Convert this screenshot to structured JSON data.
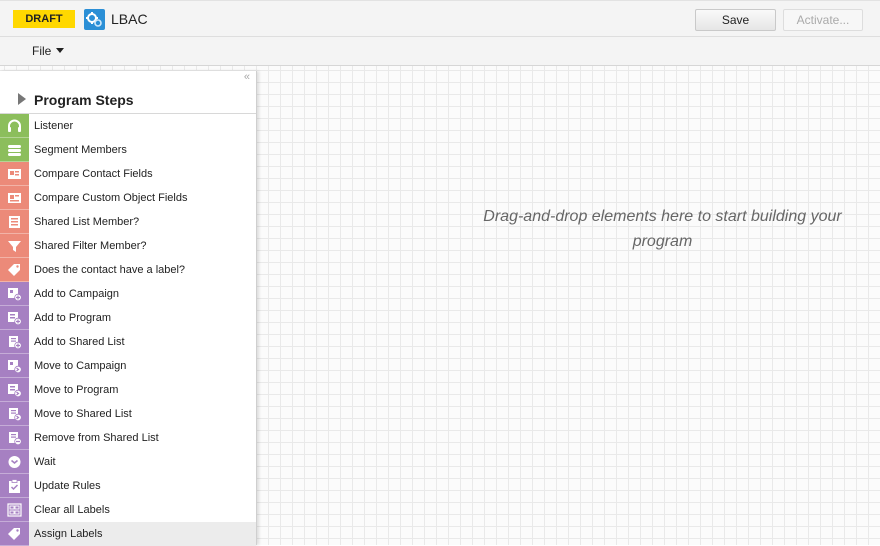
{
  "header": {
    "draft_badge": "DRAFT",
    "title": "LBAC",
    "save_label": "Save",
    "activate_label": "Activate..."
  },
  "menu": {
    "file_label": "File"
  },
  "canvas": {
    "hint": "Drag-and-drop elements here to start building your program"
  },
  "panel": {
    "collapse_glyph": "«",
    "title": "Program Steps",
    "steps": [
      {
        "label": "Listener",
        "icon": "headphones-icon",
        "color": "#8cbe5c"
      },
      {
        "label": "Segment Members",
        "icon": "segment-icon",
        "color": "#8cbe5c"
      },
      {
        "label": "Compare Contact Fields",
        "icon": "contact-card-icon",
        "color": "#ec8a79"
      },
      {
        "label": "Compare Custom Object Fields",
        "icon": "custom-object-icon",
        "color": "#ec8a79"
      },
      {
        "label": "Shared List Member?",
        "icon": "list-icon",
        "color": "#ec8a79"
      },
      {
        "label": "Shared Filter Member?",
        "icon": "filter-icon",
        "color": "#ec8a79"
      },
      {
        "label": "Does the contact have a label?",
        "icon": "tag-icon",
        "color": "#ec8a79"
      },
      {
        "label": "Add to Campaign",
        "icon": "add-campaign-icon",
        "color": "#a680c2"
      },
      {
        "label": "Add to Program",
        "icon": "add-program-icon",
        "color": "#a680c2"
      },
      {
        "label": "Add to Shared List",
        "icon": "add-list-icon",
        "color": "#a680c2"
      },
      {
        "label": "Move to Campaign",
        "icon": "move-campaign-icon",
        "color": "#a680c2"
      },
      {
        "label": "Move to Program",
        "icon": "move-program-icon",
        "color": "#a680c2"
      },
      {
        "label": "Move to Shared List",
        "icon": "move-list-icon",
        "color": "#a680c2"
      },
      {
        "label": "Remove from Shared List",
        "icon": "remove-list-icon",
        "color": "#a680c2"
      },
      {
        "label": "Wait",
        "icon": "clock-icon",
        "color": "#a680c2"
      },
      {
        "label": "Update Rules",
        "icon": "clipboard-icon",
        "color": "#a680c2"
      },
      {
        "label": "Clear all Labels",
        "icon": "clear-labels-icon",
        "color": "#a680c2"
      },
      {
        "label": "Assign Labels",
        "icon": "assign-label-icon",
        "color": "#a680c2",
        "highlighted": true
      }
    ]
  },
  "colors": {
    "draft_badge": "#ffd800",
    "logo": "#2b8fd6",
    "listener_group": "#8cbe5c",
    "decision_group": "#ec8a79",
    "action_group": "#a680c2"
  }
}
